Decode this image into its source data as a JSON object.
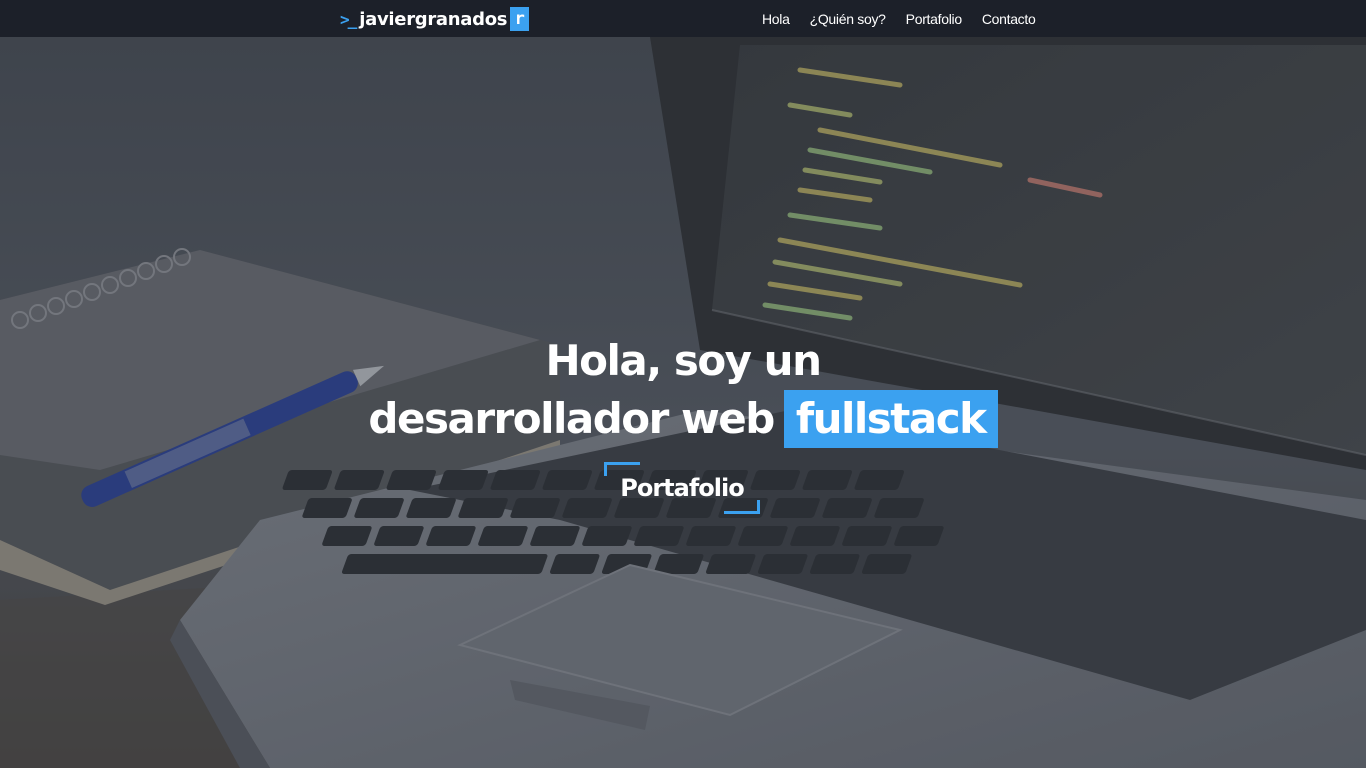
{
  "nav": {
    "brand_prompt": ">_",
    "brand_name": "javiergranados",
    "brand_cursor": "r",
    "links": [
      "Hola",
      "¿Quién soy?",
      "Portafolio",
      "Contacto"
    ]
  },
  "hero": {
    "headline_line1": "Hola, soy un",
    "headline_line2": "desarrollador web",
    "headline_highlight": "fullstack",
    "cta_label": "Portafolio"
  },
  "colors": {
    "accent": "#3ba1f0",
    "navbar": "#1c2029"
  },
  "icons": [
    "terminal-prompt-icon"
  ]
}
